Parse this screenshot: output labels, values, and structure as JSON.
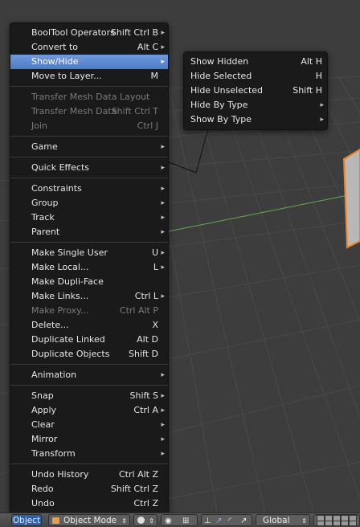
{
  "main_menu": {
    "items": [
      {
        "label": "BoolTool Operators",
        "shortcut": "Shift Ctrl B",
        "submenu": true
      },
      {
        "label": "Convert to",
        "shortcut": "Alt C",
        "submenu": true
      },
      {
        "label": "Show/Hide",
        "shortcut": "",
        "submenu": true
      },
      {
        "label": "Move to Layer...",
        "shortcut": "M",
        "submenu": false
      },
      {
        "label": "Transfer Mesh Data Layout",
        "shortcut": "",
        "submenu": false
      },
      {
        "label": "Transfer Mesh Data",
        "shortcut": "Shift Ctrl T",
        "submenu": false
      },
      {
        "label": "Join",
        "shortcut": "Ctrl J",
        "submenu": false
      },
      {
        "label": "Game",
        "shortcut": "",
        "submenu": true
      },
      {
        "label": "Quick Effects",
        "shortcut": "",
        "submenu": true
      },
      {
        "label": "Constraints",
        "shortcut": "",
        "submenu": true
      },
      {
        "label": "Group",
        "shortcut": "",
        "submenu": true
      },
      {
        "label": "Track",
        "shortcut": "",
        "submenu": true
      },
      {
        "label": "Parent",
        "shortcut": "",
        "submenu": true
      },
      {
        "label": "Make Single User",
        "shortcut": "U",
        "submenu": true
      },
      {
        "label": "Make Local...",
        "shortcut": "L",
        "submenu": true
      },
      {
        "label": "Make Dupli-Face",
        "shortcut": "",
        "submenu": false
      },
      {
        "label": "Make Links...",
        "shortcut": "Ctrl L",
        "submenu": true
      },
      {
        "label": "Make Proxy...",
        "shortcut": "Ctrl Alt P",
        "submenu": false
      },
      {
        "label": "Delete...",
        "shortcut": "X",
        "submenu": false
      },
      {
        "label": "Duplicate Linked",
        "shortcut": "Alt D",
        "submenu": false
      },
      {
        "label": "Duplicate Objects",
        "shortcut": "Shift D",
        "submenu": false
      },
      {
        "label": "Animation",
        "shortcut": "",
        "submenu": true
      },
      {
        "label": "Snap",
        "shortcut": "Shift S",
        "submenu": true
      },
      {
        "label": "Apply",
        "shortcut": "Ctrl A",
        "submenu": true
      },
      {
        "label": "Clear",
        "shortcut": "",
        "submenu": true
      },
      {
        "label": "Mirror",
        "shortcut": "",
        "submenu": true
      },
      {
        "label": "Transform",
        "shortcut": "",
        "submenu": true
      },
      {
        "label": "Undo History",
        "shortcut": "Ctrl Alt Z",
        "submenu": false
      },
      {
        "label": "Redo",
        "shortcut": "Shift Ctrl Z",
        "submenu": false
      },
      {
        "label": "Undo",
        "shortcut": "Ctrl Z",
        "submenu": false
      }
    ]
  },
  "show_hide_submenu": {
    "items": [
      {
        "label": "Show Hidden",
        "shortcut": "Alt H",
        "submenu": false
      },
      {
        "label": "Hide Selected",
        "shortcut": "H",
        "submenu": false
      },
      {
        "label": "Hide Unselected",
        "shortcut": "Shift H",
        "submenu": false
      },
      {
        "label": "Hide By Type",
        "shortcut": "",
        "submenu": true
      },
      {
        "label": "Show By Type",
        "shortcut": "",
        "submenu": true
      }
    ]
  },
  "header": {
    "object_menu": "Object",
    "mode": "Object Mode",
    "orientation": "Global",
    "icons": [
      "object-mode-cube-icon",
      "viewport-shading-sphere-icon",
      "pivot-icon",
      "manipulator-translate-icon",
      "manipulator-rotate-icon",
      "manipulator-scale-icon",
      "layers-grid-icon"
    ]
  },
  "colors": {
    "menu_bg": "#191919",
    "highlight": "#5680c2",
    "disabled_text": "#7b7b7b",
    "viewport_bg": "#3d3d3d",
    "grid": "#4a4a4a",
    "x_axis": "#6aa84f",
    "selection_outline": "#f08020"
  },
  "arrow_glyph": "▸"
}
